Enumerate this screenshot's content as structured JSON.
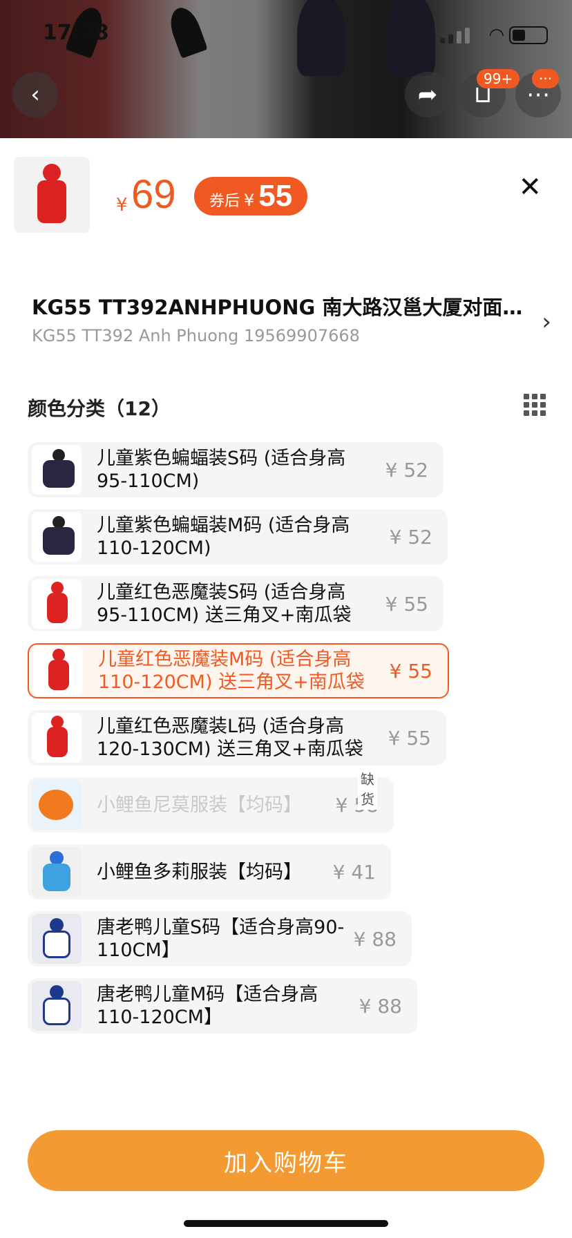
{
  "status_bar": {
    "time": "17:28"
  },
  "header": {
    "cart_badge": "99+",
    "more_badge": "···"
  },
  "product": {
    "currency": "¥",
    "price": "69",
    "coupon_label": "券后",
    "coupon_currency": "¥",
    "coupon_price": "55"
  },
  "address": {
    "title": "KG55 TT392ANHPHUONG 南大路汉邕大厦对面…",
    "subtitle": "KG55 TT392 Anh Phuong 19569907668"
  },
  "section": {
    "title": "颜色分类（12）"
  },
  "options": [
    {
      "name": "儿童紫色蝙蝠装S码 (适合身高95-110CM)",
      "price": "¥ 52",
      "state": "normal",
      "thumb": "bat"
    },
    {
      "name": "儿童紫色蝙蝠装M码 (适合身高110-120CM)",
      "price": "¥ 52",
      "state": "normal",
      "thumb": "bat"
    },
    {
      "name": "儿童红色恶魔装S码 (适合身高95-110CM) 送三角叉+南瓜袋",
      "price": "¥ 55",
      "state": "normal",
      "thumb": "devil"
    },
    {
      "name": "儿童红色恶魔装M码 (适合身高110-120CM) 送三角叉+南瓜袋",
      "price": "¥ 55",
      "state": "selected",
      "thumb": "devil"
    },
    {
      "name": "儿童红色恶魔装L码 (适合身高120-130CM) 送三角叉+南瓜袋",
      "price": "¥ 55",
      "state": "normal",
      "thumb": "devil"
    },
    {
      "name": "小鲤鱼尼莫服装【均码】",
      "price": "¥ 58",
      "state": "disabled",
      "thumb": "nemo",
      "stock_label": "缺货"
    },
    {
      "name": "小鲤鱼多莉服装【均码】",
      "price": "¥ 41",
      "state": "normal",
      "thumb": "dory"
    },
    {
      "name": "唐老鸭儿童S码【适合身高90-110CM】",
      "price": "¥ 88",
      "state": "normal",
      "thumb": "duck"
    },
    {
      "name": "唐老鸭儿童M码【适合身高110-120CM】",
      "price": "¥ 88",
      "state": "normal",
      "thumb": "duck"
    }
  ],
  "cart_button": {
    "label": "加入购物车"
  },
  "colors": {
    "accent": "#f05a22",
    "button": "#f39a33"
  }
}
